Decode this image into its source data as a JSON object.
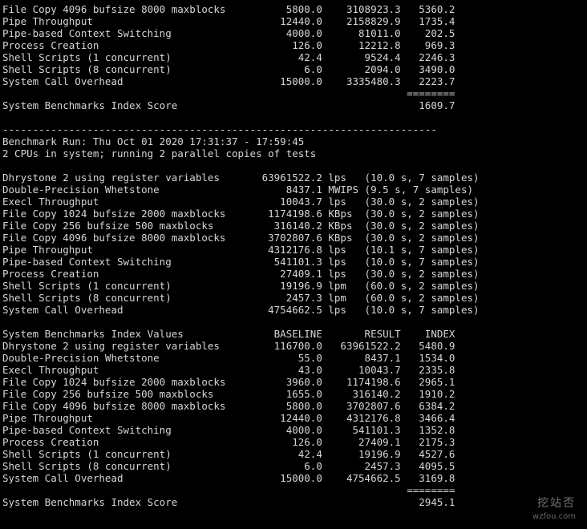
{
  "terminal": {
    "lines": [
      "File Copy 4096 bufsize 8000 maxblocks          5800.0    3108923.3   5360.2",
      "Pipe Throughput                               12440.0    2158829.9   1735.4",
      "Pipe-based Context Switching                   4000.0      81011.0    202.5",
      "Process Creation                                126.0      12212.8    969.3",
      "Shell Scripts (1 concurrent)                     42.4       9524.4   2246.3",
      "Shell Scripts (8 concurrent)                      6.0       2094.0   3490.0",
      "System Call Overhead                          15000.0    3335480.3   2223.7",
      "                                                                   ========",
      "System Benchmarks Index Score                                        1609.7",
      "",
      "------------------------------------------------------------------------",
      "Benchmark Run: Thu Oct 01 2020 17:31:37 - 17:59:45",
      "2 CPUs in system; running 2 parallel copies of tests",
      "",
      "Dhrystone 2 using register variables       63961522.2 lps   (10.0 s, 7 samples)",
      "Double-Precision Whetstone                     8437.1 MWIPS (9.5 s, 7 samples)",
      "Execl Throughput                              10043.7 lps   (30.0 s, 2 samples)",
      "File Copy 1024 bufsize 2000 maxblocks       1174198.6 KBps  (30.0 s, 2 samples)",
      "File Copy 256 bufsize 500 maxblocks          316140.2 KBps  (30.0 s, 2 samples)",
      "File Copy 4096 bufsize 8000 maxblocks       3702807.6 KBps  (30.0 s, 2 samples)",
      "Pipe Throughput                             4312176.8 lps   (10.1 s, 7 samples)",
      "Pipe-based Context Switching                 541101.3 lps   (10.0 s, 7 samples)",
      "Process Creation                              27409.1 lps   (30.0 s, 2 samples)",
      "Shell Scripts (1 concurrent)                  19196.9 lpm   (60.0 s, 2 samples)",
      "Shell Scripts (8 concurrent)                   2457.3 lpm   (60.0 s, 2 samples)",
      "System Call Overhead                        4754662.5 lps   (10.0 s, 7 samples)",
      "",
      "System Benchmarks Index Values               BASELINE       RESULT    INDEX",
      "Dhrystone 2 using register variables         116700.0   63961522.2   5480.9",
      "Double-Precision Whetstone                       55.0       8437.1   1534.0",
      "Execl Throughput                                 43.0      10043.7   2335.8",
      "File Copy 1024 bufsize 2000 maxblocks          3960.0    1174198.6   2965.1",
      "File Copy 256 bufsize 500 maxblocks            1655.0     316140.2   1910.2",
      "File Copy 4096 bufsize 8000 maxblocks          5800.0    3702807.6   6384.2",
      "Pipe Throughput                               12440.0    4312176.8   3466.4",
      "Pipe-based Context Switching                   4000.0     541101.3   1352.8",
      "Process Creation                                126.0      27409.1   2175.3",
      "Shell Scripts (1 concurrent)                     42.4      19196.9   4527.6",
      "Shell Scripts (8 concurrent)                      6.0       2457.3   4095.5",
      "System Call Overhead                          15000.0    4754662.5   3169.8",
      "                                                                   ========",
      "System Benchmarks Index Score                                        2945.1"
    ]
  },
  "watermark": {
    "name": "挖站否",
    "domain": "wzfou.com"
  }
}
